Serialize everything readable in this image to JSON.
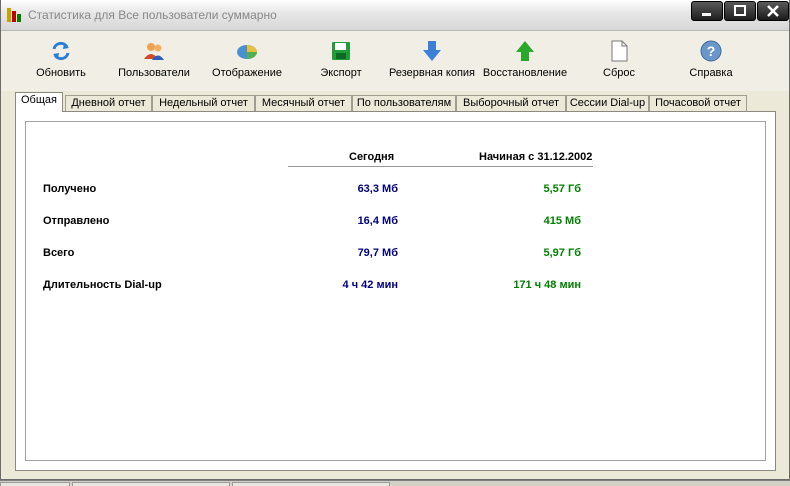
{
  "window": {
    "title": "Статистика для Все пользователи суммарно"
  },
  "toolbar": {
    "items": [
      {
        "label": "Обновить",
        "icon": "refresh-icon"
      },
      {
        "label": "Пользователи",
        "icon": "users-icon"
      },
      {
        "label": "Отображение",
        "icon": "display-icon"
      },
      {
        "label": "Экспорт",
        "icon": "floppy-disk-icon"
      },
      {
        "label": "Резервная копия",
        "icon": "arrow-down-icon"
      },
      {
        "label": "Восстановление",
        "icon": "arrow-up-icon"
      },
      {
        "label": "Сброс",
        "icon": "blank-page-icon"
      },
      {
        "label": "Справка",
        "icon": "help-icon"
      }
    ]
  },
  "tabs": [
    {
      "label": "Общая",
      "active": true
    },
    {
      "label": "Дневной отчет"
    },
    {
      "label": "Недельный отчет"
    },
    {
      "label": "Месячный отчет"
    },
    {
      "label": "По пользователям"
    },
    {
      "label": "Выборочный отчет"
    },
    {
      "label": "Сессии Dial-up"
    },
    {
      "label": "Почасовой отчет"
    }
  ],
  "stats": {
    "col_today": "Сегодня",
    "col_since": "Начиная с 31.12.2002",
    "rows": [
      {
        "label": "Получено",
        "today": "63,3 Мб",
        "total": "5,57 Гб"
      },
      {
        "label": "Отправлено",
        "today": "16,4 Мб",
        "total": "415 Мб"
      },
      {
        "label": "Всего",
        "today": "79,7 Мб",
        "total": "5,97 Гб"
      },
      {
        "label": "Длительность Dial-up",
        "today": "4 ч 42 мин",
        "total": "171 ч 48 мин"
      }
    ]
  },
  "colors": {
    "today_value": "#000080",
    "total_value": "#008000"
  }
}
